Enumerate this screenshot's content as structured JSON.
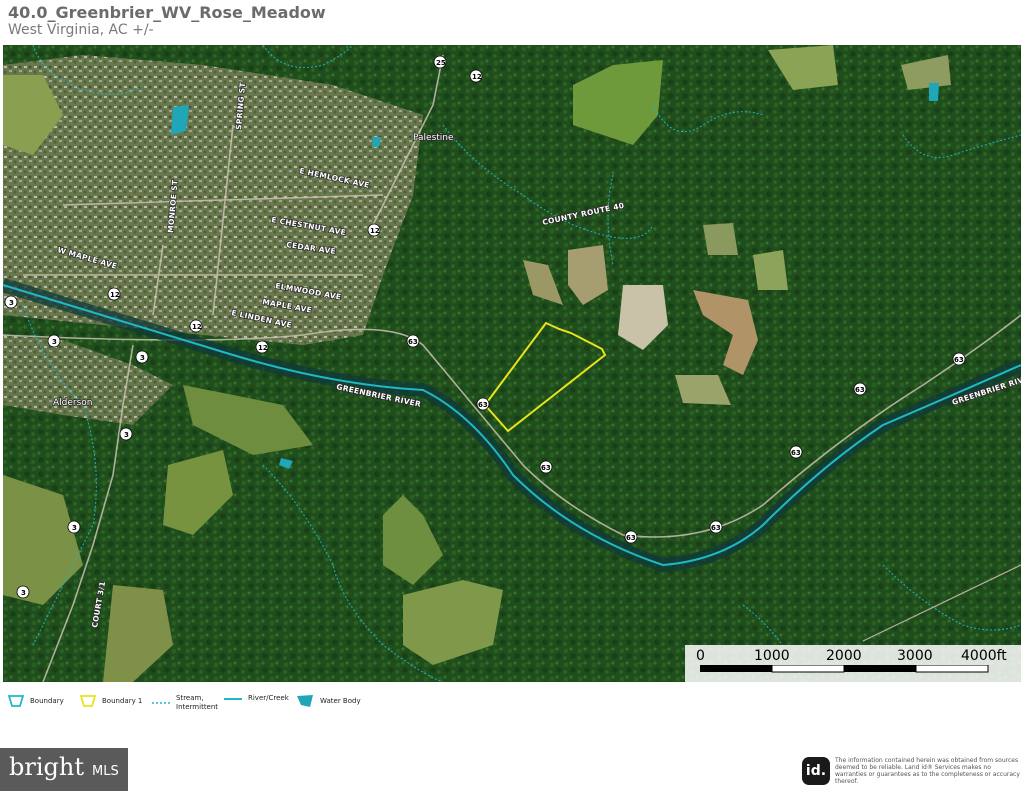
{
  "header": {
    "title": "40.0_Greenbrier_WV_Rose_Meadow",
    "subtitle": "West Virginia,  AC +/-"
  },
  "map": {
    "imagery": "aerial satellite (forest, farmland, town)",
    "colors": {
      "boundary": "#e8e419",
      "river": "#1fb8c8",
      "stream": "#1fb8c8",
      "water_body": "#1fa6b8"
    },
    "street_labels": {
      "e_hemlock": "E HEMLOCK AVE",
      "e_chestnut": "E CHESTNUT AVE",
      "cedar": "CEDAR AVE",
      "elmwood": "ELMWOOD AVE",
      "maple": "MAPLE AVE",
      "e_linden": "E LINDEN AVE",
      "w_maple": "W MAPLE AVE",
      "monroe": "MONROE ST",
      "spring": "SPRING ST",
      "county_route": "COUNTY ROUTE 40",
      "river_label": "GREENBRIER RIVER",
      "river_label_east": "GREENBRIER RIVER",
      "court": "COURT 3/1"
    },
    "places": {
      "palestine": "Palestine",
      "alderson": "Alderson"
    },
    "route_shields": [
      "25",
      "12",
      "12",
      "12",
      "12",
      "12",
      "3",
      "3",
      "3",
      "3",
      "3",
      "3",
      "63",
      "63",
      "63",
      "63",
      "63",
      "63",
      "63",
      "63"
    ]
  },
  "scale_bar": {
    "labels": [
      "0",
      "1000",
      "2000",
      "3000",
      "4000ft"
    ]
  },
  "legend": {
    "items": [
      {
        "label": "Boundary",
        "icon": "boundary-icon"
      },
      {
        "label": "Boundary 1",
        "icon": "boundary1-icon"
      },
      {
        "label": "Stream,\nIntermittent",
        "icon": "stream-icon"
      },
      {
        "label": "River/Creek",
        "icon": "river-icon"
      },
      {
        "label": "Water Body",
        "icon": "water-body-icon"
      }
    ]
  },
  "footer": {
    "brand": "bright",
    "brand_suffix": "MLS",
    "id_logo": "id.",
    "disclaimer": "The information contained herein was obtained from sources deemed to be reliable. Land id® Services makes no warranties or guarantees as to the completeness or accuracy thereof."
  }
}
